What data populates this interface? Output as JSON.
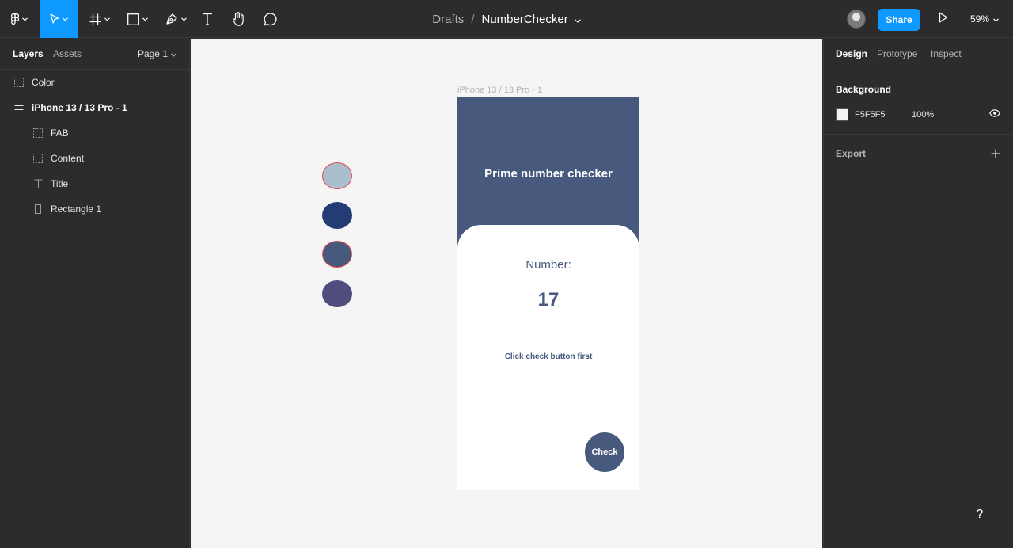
{
  "toolbar": {
    "tools": [
      {
        "name": "main-menu",
        "icon": "figma-logo-icon",
        "active": false
      },
      {
        "name": "move",
        "icon": "cursor-icon",
        "active": true
      },
      {
        "name": "frame",
        "icon": "frame-hash-icon",
        "active": false
      },
      {
        "name": "shape",
        "icon": "rectangle-icon",
        "active": false
      },
      {
        "name": "pen",
        "icon": "pen-icon",
        "active": false
      },
      {
        "name": "text",
        "icon": "text-t-icon",
        "active": false
      },
      {
        "name": "hand",
        "icon": "hand-icon",
        "active": false
      },
      {
        "name": "comment",
        "icon": "comment-bubble-icon",
        "active": false
      }
    ],
    "breadcrumb": {
      "folder": "Drafts",
      "separator": "/",
      "file": "NumberChecker"
    },
    "share_label": "Share",
    "zoom": "59%",
    "accent": "#0d99ff"
  },
  "left_panel": {
    "tabs": {
      "layers": "Layers",
      "assets": "Assets"
    },
    "page": "Page 1",
    "layers": [
      {
        "label": "Color",
        "icon": "dashed-group-icon",
        "depth": 0,
        "bold": false
      },
      {
        "label": "iPhone 13 / 13 Pro - 1",
        "icon": "frame-hash-icon",
        "depth": 0,
        "bold": true
      },
      {
        "label": "FAB",
        "icon": "dashed-group-icon",
        "depth": 1,
        "bold": false
      },
      {
        "label": "Content",
        "icon": "dashed-group-icon",
        "depth": 1,
        "bold": false
      },
      {
        "label": "Title",
        "icon": "text-t-icon",
        "depth": 1,
        "bold": false
      },
      {
        "label": "Rectangle 1",
        "icon": "rectangle-outline-icon",
        "depth": 1,
        "bold": false
      }
    ]
  },
  "canvas": {
    "background": "#f5f5f5",
    "swatches": [
      {
        "color": "#a9bfcd",
        "selected_outline": true
      },
      {
        "color": "#243b73",
        "selected_outline": false
      },
      {
        "color": "#475a7e",
        "selected_outline": true
      },
      {
        "color": "#4f4d7d",
        "selected_outline": false
      }
    ],
    "frame_label": "iPhone 13 / 13 Pro - 1",
    "phone": {
      "header_color": "#475a7e",
      "title": "Prime number checker",
      "number_label": "Number:",
      "number_value": "17",
      "hint": "Click check button first",
      "fab_label": "Check"
    }
  },
  "right_panel": {
    "tabs": {
      "design": "Design",
      "prototype": "Prototype",
      "inspect": "Inspect"
    },
    "background": {
      "title": "Background",
      "hex": "F5F5F5",
      "opacity": "100%",
      "swatch": "#f5f5f5"
    },
    "export": {
      "title": "Export"
    }
  },
  "help": "?"
}
